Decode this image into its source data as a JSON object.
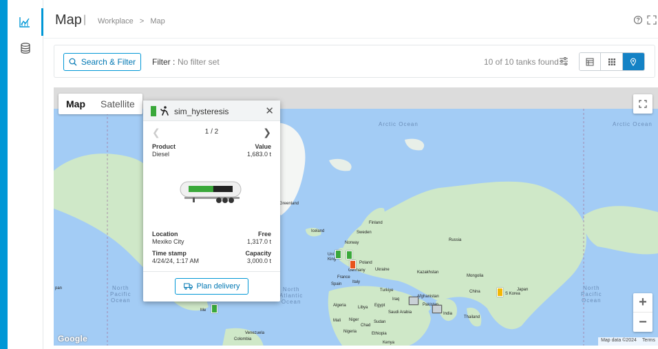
{
  "header": {
    "title": "Map",
    "separator": "|",
    "breadcrumbs": [
      "Workplace",
      ">",
      "Map"
    ]
  },
  "sidebar": {
    "items": [
      {
        "icon": "chart-icon",
        "active": true
      },
      {
        "icon": "database-icon",
        "active": false
      }
    ]
  },
  "filterbar": {
    "search_label": "Search & Filter",
    "filter_label": "Filter :",
    "filter_value": "No filter set",
    "found_text": "10 of 10 tanks found"
  },
  "map": {
    "type_options": [
      "Map",
      "Satellite"
    ],
    "selected_type": "Map",
    "zoom_in": "+",
    "zoom_out": "−",
    "attribution": "Map data ©2024",
    "terms": "Terms",
    "google": "Google",
    "ocean_labels": {
      "arctic1": "Arctic Ocean",
      "arctic2": "Arctic Ocean",
      "north_pacific_line1": "North",
      "north_pacific_line2": "Pacific",
      "north_pacific_line3": "Ocean",
      "north_pacific2_line1": "North",
      "north_pacific2_line2": "Pacific",
      "north_pacific2_line3": "Ocean",
      "north_atlantic_line1": "North",
      "north_atlantic_line2": "Atlantic",
      "north_atlantic_line3": "Ocean"
    },
    "place_labels": {
      "greenland": "Greenland",
      "iceland": "Iceland",
      "finland": "Finland",
      "sweden": "Sweden",
      "norway": "Norway",
      "russia": "Russia",
      "uk": "Uni King",
      "poland": "Poland",
      "germany": "Germany",
      "ukraine": "Ukraine",
      "france": "France",
      "kazakhstan": "Kazakhstan",
      "mongolia": "Mongolia",
      "spain": "Spain",
      "italy": "Italy",
      "turkiye": "Turkiye",
      "china": "China",
      "japan": "Japan",
      "korea": "S Korea",
      "iraq": "Iraq",
      "afghanistan": "Afghanistan",
      "pakistan": "Pakistan",
      "india": "India",
      "algeria": "Algeria",
      "libya": "Libya",
      "egypt": "Egypt",
      "saudi": "Saudi Arabia",
      "thailand": "Thailand",
      "mali": "Mali",
      "niger": "Niger",
      "chad": "Chad",
      "sudan": "Sudan",
      "nigeria": "Nigeria",
      "ethiopia": "Ethiopia",
      "kenya": "Kenya",
      "venezuela": "Venezuela",
      "colombia": "Colombia",
      "mexico": "Me",
      "pan": "pan"
    },
    "marker_colors": {
      "green": "#3aa83a",
      "orange": "#e8541c",
      "yellow": "#f2b705",
      "grey": "#9aa4ab"
    }
  },
  "popup": {
    "tank_name": "sim_hysteresis",
    "pager": "1 / 2",
    "product_label": "Product",
    "product_value": "Diesel",
    "value_label": "Value",
    "value_value": "1,683.0 t",
    "location_label": "Location",
    "location_value": "Mexiko City",
    "free_label": "Free",
    "free_value": "1,317.0 t",
    "timestamp_label": "Time stamp",
    "timestamp_value": "4/24/24, 1:17 AM",
    "capacity_label": "Capacity",
    "capacity_value": "3,000.0 t",
    "fill_fraction": 0.561,
    "plan_label": "Plan delivery"
  },
  "colors": {
    "accent": "#0097d6",
    "ocean": "#a3ccf5",
    "land": "#cfe8c8",
    "tank_green": "#3aa83a"
  }
}
